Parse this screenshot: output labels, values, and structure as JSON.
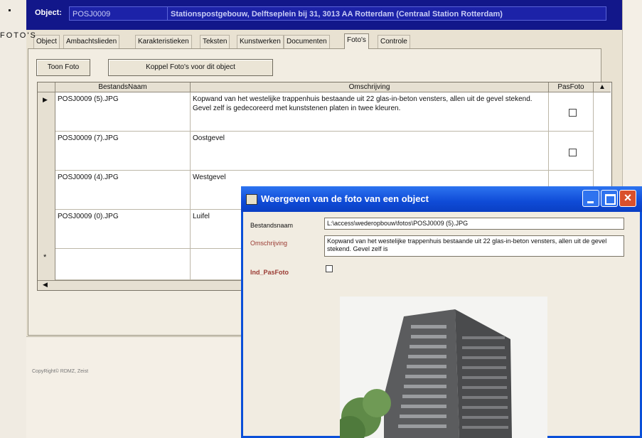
{
  "watermark": "FOTO'S",
  "header": {
    "object_label": "Object:",
    "object_id": "POSJ0009",
    "object_description": "Stationspostgebouw, Delftseplein bij 31, 3013 AA Rotterdam (Centraal Station Rotterdam)"
  },
  "tabs": [
    "Object",
    "Ambachtslieden",
    "Karakteristieken",
    "Teksten",
    "Kunstwerken",
    "Documenten",
    "Foto's",
    "Controle"
  ],
  "active_tab": "Foto's",
  "buttons": {
    "show_photo": "Toon Foto",
    "link_photos": "Koppel Foto's voor dit object"
  },
  "table": {
    "columns": [
      "BestandsNaam",
      "Omschrijving",
      "PasFoto"
    ],
    "rows": [
      {
        "file": "POSJ0009 (5).JPG",
        "description": "Kopwand van het westelijke trappenhuis bestaande uit 22 glas-in-beton vensters, allen uit de gevel stekend. Gevel zelf is gedecoreerd met kunststenen platen in twee kleuren.",
        "pasfoto": false
      },
      {
        "file": "POSJ0009 (7).JPG",
        "description": "Oostgevel",
        "pasfoto": false
      },
      {
        "file": "POSJ0009 (4).JPG",
        "description": "Westgevel",
        "pasfoto": false
      },
      {
        "file": "POSJ0009 (0).JPG",
        "description": "Luifel",
        "pasfoto": false
      }
    ],
    "new_row_marker": "*",
    "current_row_marker": "▶"
  },
  "copyright": "CopyRight© RDMZ, Zeist",
  "dialog": {
    "title": "Weergeven van de foto van een object",
    "filename_label": "Bestandsnaam",
    "filename_value": "L:\\access\\wederopbouw\\fotos\\POSJ0009 (5).JPG",
    "description_label": "Omschrijving",
    "description_value": "Kopwand van het westelijke trappenhuis bestaande uit 22 glas-in-beton vensters, allen uit de gevel stekend. Gevel zelf is",
    "pasfoto_label": "Ind_PasFoto",
    "pasfoto_checked": false
  },
  "colors": {
    "header_bg": "#12178a",
    "dialog_title": "#0f4bd7",
    "label_red": "#9a3a32"
  }
}
